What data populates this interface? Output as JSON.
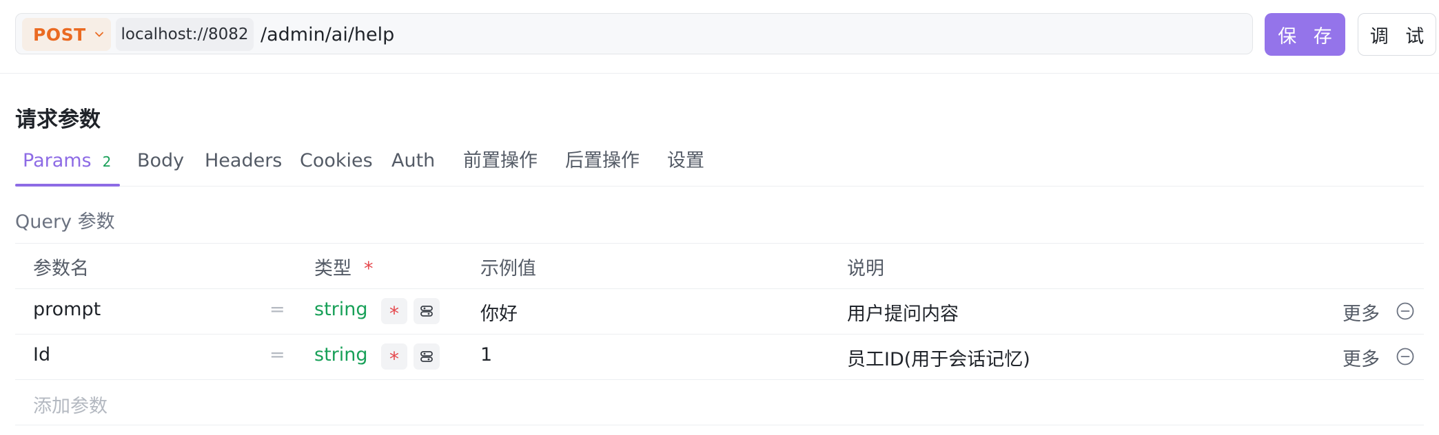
{
  "request": {
    "method": "POST",
    "host": "localhost://8082",
    "path": "/admin/ai/help",
    "save_label": "保 存",
    "debug_label": "调 试"
  },
  "section_title": "请求参数",
  "tabs": [
    {
      "label": "Params",
      "badge": "2"
    },
    {
      "label": "Body"
    },
    {
      "label": "Headers"
    },
    {
      "label": "Cookies"
    },
    {
      "label": "Auth"
    },
    {
      "label": "前置操作"
    },
    {
      "label": "后置操作"
    },
    {
      "label": "设置"
    }
  ],
  "query_title": "Query 参数",
  "table": {
    "headers": {
      "name": "参数名",
      "type": "类型",
      "type_required": "*",
      "example": "示例值",
      "description": "说明"
    },
    "rows": [
      {
        "name": "prompt",
        "eq": "=",
        "type": "string",
        "required": "*",
        "example": "你好",
        "description": "用户提问内容",
        "more": "更多"
      },
      {
        "name": "Id",
        "eq": "=",
        "type": "string",
        "required": "*",
        "example": "1",
        "description": "员工ID(用于会话记忆)",
        "more": "更多"
      }
    ],
    "add_placeholder": "添加参数"
  },
  "colors": {
    "accent": "#8d6be5",
    "method": "#ea6a22",
    "type": "#18a058",
    "required": "#e5484d"
  },
  "icons": [
    "chevron-down-icon",
    "link-icon",
    "minus-circle-icon"
  ]
}
